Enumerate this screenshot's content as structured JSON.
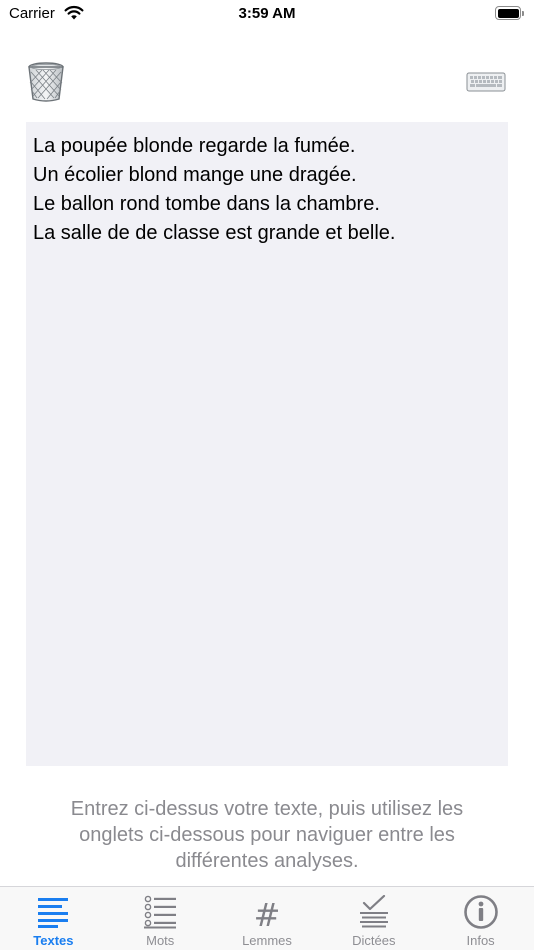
{
  "status_bar": {
    "carrier": "Carrier",
    "time": "3:59 AM"
  },
  "toolbar": {
    "trash_icon": "trash-icon",
    "keyboard_icon": "keyboard-icon"
  },
  "editor": {
    "lines": [
      "La poupée blonde regarde la fumée.",
      "Un écolier blond mange une dragée.",
      "Le ballon rond tombe dans la chambre.",
      "La salle de de classe est grande et belle."
    ]
  },
  "hint": {
    "lines": [
      "Entrez ci-dessus votre texte, puis utilisez les",
      "onglets ci-dessous pour naviguer entre les",
      "différentes analyses."
    ]
  },
  "tabs": [
    {
      "label": "Textes",
      "icon": "text-lines-icon",
      "active": true
    },
    {
      "label": "Mots",
      "icon": "list-icon",
      "active": false
    },
    {
      "label": "Lemmes",
      "icon": "hash-icon",
      "active": false
    },
    {
      "label": "Dictées",
      "icon": "checklist-icon",
      "active": false
    },
    {
      "label": "Infos",
      "icon": "info-icon",
      "active": false
    }
  ],
  "colors": {
    "accent": "#1a7ef0",
    "tab_inactive": "#8e8e93",
    "editor_background": "#f1f1f6",
    "hint_text": "#8a8a8f"
  }
}
